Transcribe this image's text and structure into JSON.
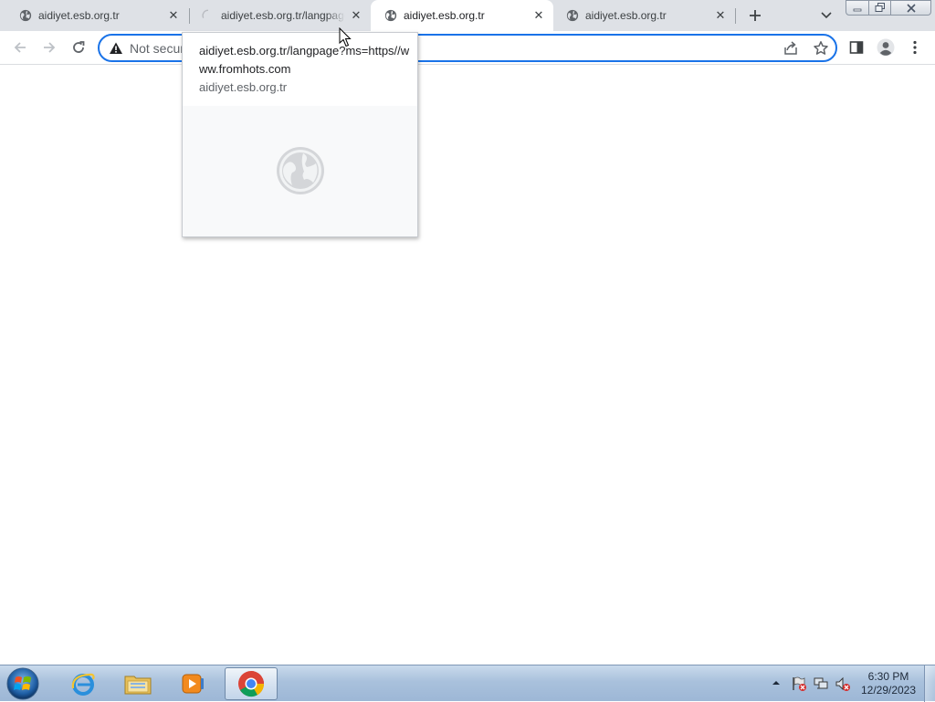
{
  "browser": {
    "tabs": [
      {
        "title": "aidiyet.esb.org.tr",
        "state": "inactive",
        "icon": "globe-icon"
      },
      {
        "title": "aidiyet.esb.org.tr/langpage",
        "state": "loading",
        "icon": "spinner-icon"
      },
      {
        "title": "aidiyet.esb.org.tr",
        "state": "active",
        "icon": "globe-icon"
      },
      {
        "title": "aidiyet.esb.org.tr",
        "state": "inactive",
        "icon": "globe-icon"
      }
    ],
    "tab_close_glyph": "✕",
    "new_tab_glyph": "+",
    "omnibox": {
      "security_label": "Not secure",
      "security_icon": "warning-triangle-icon"
    },
    "hover_card": {
      "title": "aidiyet.esb.org.tr/langpage?ms=https//www.fromhots.com",
      "domain": "aidiyet.esb.org.tr",
      "preview_icon": "globe-icon"
    }
  },
  "taskbar": {
    "apps": [
      {
        "name": "internet-explorer",
        "icon": "ie-icon"
      },
      {
        "name": "windows-explorer",
        "icon": "folder-icon"
      },
      {
        "name": "media-player",
        "icon": "media-player-icon"
      },
      {
        "name": "chrome",
        "icon": "chrome-icon",
        "active": true
      }
    ],
    "clock": {
      "time": "6:30 PM",
      "date": "12/29/2023"
    }
  },
  "colors": {
    "accent": "#1a73e8",
    "tabstrip": "#dee1e6",
    "taskbar": "#a9c1dc"
  }
}
